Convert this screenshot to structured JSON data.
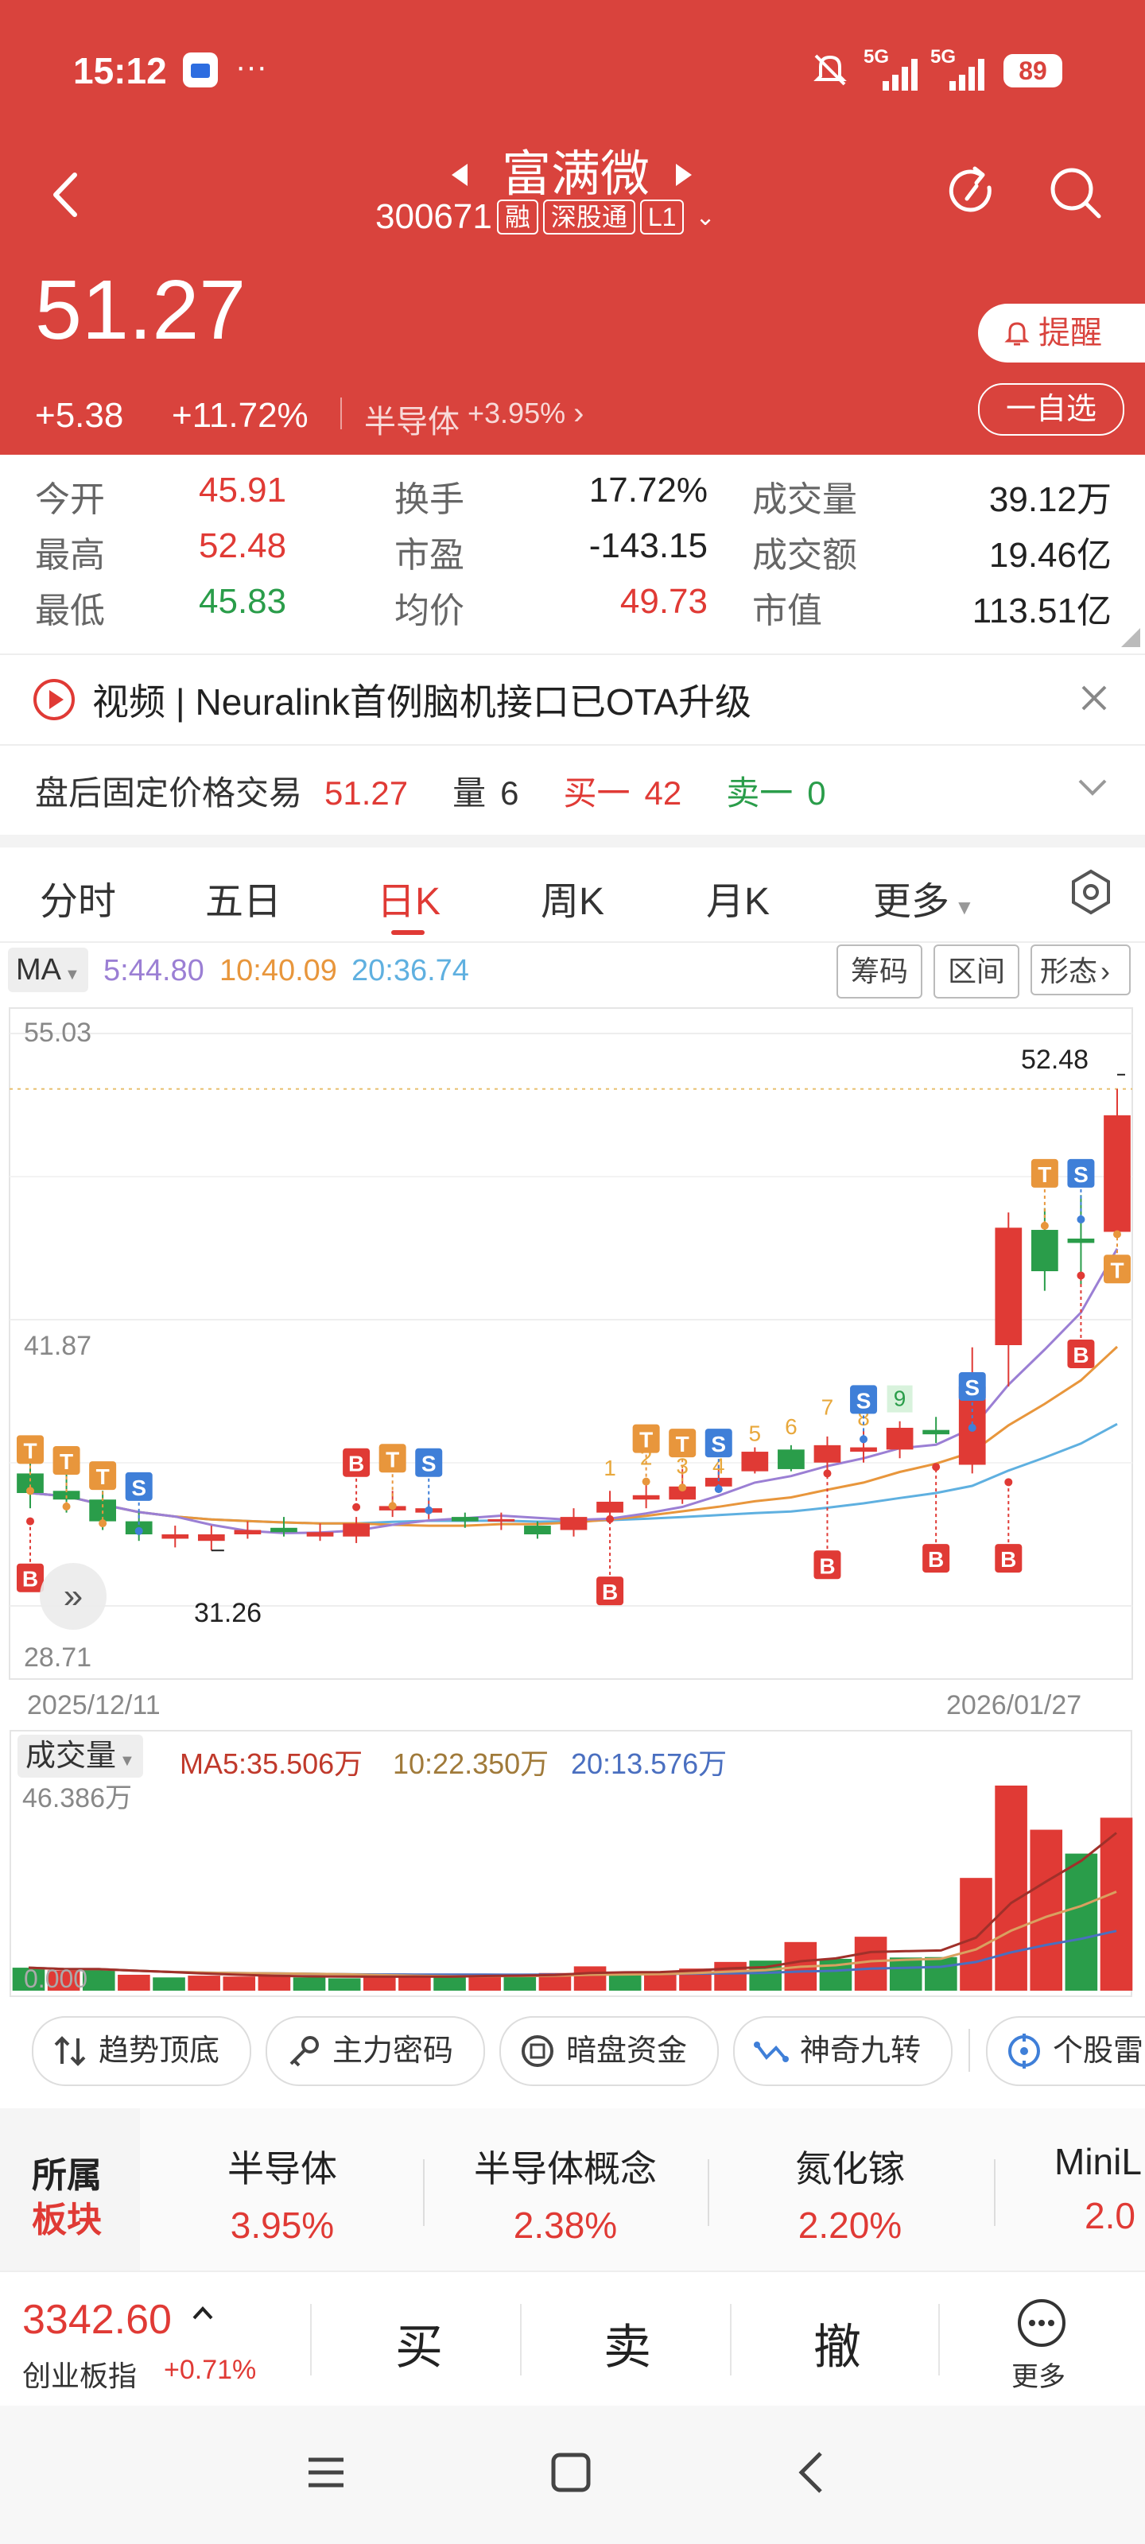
{
  "status_bar": {
    "time": "15:12",
    "network1": "5G",
    "network2": "5G",
    "battery": "89"
  },
  "header": {
    "stock_name": "富满微",
    "stock_code": "300671",
    "badges": [
      "融",
      "深股通",
      "L1"
    ],
    "price": "51.27",
    "change": "+5.38",
    "change_pct": "+11.72%",
    "sector_name": "半导体",
    "sector_change": "+3.95%",
    "alert_label": "提醒",
    "watchlist_label": "一自选"
  },
  "quote": {
    "rows": [
      [
        {
          "label": "今开",
          "value": "45.91",
          "color": "red"
        },
        {
          "label": "换手",
          "value": "17.72%",
          "color": "dark"
        },
        {
          "label": "成交量",
          "value": "39.12万",
          "color": "dark"
        }
      ],
      [
        {
          "label": "最高",
          "value": "52.48",
          "color": "red"
        },
        {
          "label": "市盈",
          "value": "-143.15",
          "color": "dark"
        },
        {
          "label": "成交额",
          "value": "19.46亿",
          "color": "dark"
        }
      ],
      [
        {
          "label": "最低",
          "value": "45.83",
          "color": "green"
        },
        {
          "label": "均价",
          "value": "49.73",
          "color": "red"
        },
        {
          "label": "市值",
          "value": "113.51亿",
          "color": "dark"
        }
      ]
    ]
  },
  "news": {
    "text": "视频 | Neuralink首例脑机接口已OTA升级"
  },
  "after_hours": {
    "label": "盘后固定价格交易",
    "price": "51.27",
    "volume_label": "量",
    "volume": "6",
    "buy_label": "买一",
    "buy_value": "42",
    "sell_label": "卖一",
    "sell_value": "0"
  },
  "chart_tabs": [
    "分时",
    "五日",
    "日K",
    "周K",
    "月K",
    "更多"
  ],
  "active_tab": "日K",
  "ma_bar": {
    "label": "MA",
    "ma5": "5:44.80",
    "ma10": "10:40.09",
    "ma20": "20:36.74",
    "buttons": [
      "筹码",
      "区间",
      "形态"
    ]
  },
  "chart_labels": {
    "ymax": "55.03",
    "ymid": "41.87",
    "ymin": "28.71",
    "high_marker": "52.48",
    "low_marker": "31.26",
    "date_start": "2025/12/11",
    "date_end": "2026/01/27"
  },
  "volume_bar": {
    "label": "成交量",
    "ma5": "MA5:35.506万",
    "ma10": "10:22.350万",
    "ma20": "20:13.576万",
    "ymax": "46.386万",
    "ymin": "0.000"
  },
  "colors": {
    "up": "#e03a35",
    "down": "#2a9d4a",
    "ma5": "#9b7fd4",
    "ma10": "#e8963c",
    "ma20": "#5fb0e0",
    "header": "#d9433d"
  },
  "chart_data": {
    "type": "candlestick",
    "ylim": [
      28.71,
      55.03
    ],
    "x_start": "2025/12/11",
    "x_end": "2026/01/27",
    "candles": [
      {
        "o": 34.8,
        "c": 33.9,
        "h": 35.6,
        "l": 33.2
      },
      {
        "o": 34.0,
        "c": 33.6,
        "h": 34.8,
        "l": 33.0
      },
      {
        "o": 33.6,
        "c": 32.6,
        "h": 34.0,
        "l": 32.2
      },
      {
        "o": 32.6,
        "c": 32.0,
        "h": 33.0,
        "l": 31.7
      },
      {
        "o": 31.8,
        "c": 32.0,
        "h": 32.4,
        "l": 31.4
      },
      {
        "o": 31.7,
        "c": 32.0,
        "h": 32.4,
        "l": 31.26
      },
      {
        "o": 32.0,
        "c": 32.2,
        "h": 32.6,
        "l": 31.8
      },
      {
        "o": 32.3,
        "c": 32.1,
        "h": 32.8,
        "l": 31.9
      },
      {
        "o": 31.9,
        "c": 32.1,
        "h": 32.5,
        "l": 31.7
      },
      {
        "o": 31.9,
        "c": 32.5,
        "h": 32.8,
        "l": 31.6
      },
      {
        "o": 33.1,
        "c": 33.3,
        "h": 34.0,
        "l": 32.8
      },
      {
        "o": 33.0,
        "c": 33.2,
        "h": 33.6,
        "l": 32.7
      },
      {
        "o": 32.8,
        "c": 32.6,
        "h": 33.0,
        "l": 32.3
      },
      {
        "o": 32.6,
        "c": 32.7,
        "h": 33.0,
        "l": 32.2
      },
      {
        "o": 32.4,
        "c": 32.0,
        "h": 32.6,
        "l": 31.8
      },
      {
        "o": 32.2,
        "c": 32.8,
        "h": 33.2,
        "l": 31.9
      },
      {
        "o": 33.0,
        "c": 33.5,
        "h": 34.0,
        "l": 32.5
      },
      {
        "o": 33.6,
        "c": 33.8,
        "h": 34.6,
        "l": 33.2
      },
      {
        "o": 33.6,
        "c": 34.2,
        "h": 35.0,
        "l": 33.4
      },
      {
        "o": 34.2,
        "c": 34.6,
        "h": 35.2,
        "l": 34.0
      },
      {
        "o": 34.9,
        "c": 35.8,
        "h": 36.0,
        "l": 34.8
      },
      {
        "o": 35.9,
        "c": 35.0,
        "h": 36.1,
        "l": 34.9
      },
      {
        "o": 35.3,
        "c": 36.1,
        "h": 36.5,
        "l": 34.8
      },
      {
        "o": 35.8,
        "c": 36.0,
        "h": 36.8,
        "l": 35.3
      },
      {
        "o": 35.9,
        "c": 36.9,
        "h": 37.2,
        "l": 35.5
      },
      {
        "o": 36.8,
        "c": 36.6,
        "h": 37.4,
        "l": 36.2
      },
      {
        "o": 35.2,
        "c": 38.8,
        "h": 40.6,
        "l": 34.8
      },
      {
        "o": 40.7,
        "c": 46.1,
        "h": 46.8,
        "l": 38.8
      },
      {
        "o": 46.0,
        "c": 44.1,
        "h": 47.0,
        "l": 43.2
      },
      {
        "o": 45.6,
        "c": 45.4,
        "h": 47.6,
        "l": 43.5
      },
      {
        "o": 45.91,
        "c": 51.27,
        "h": 52.48,
        "l": 45.83
      }
    ],
    "volume_ylim": [
      0,
      46.386
    ],
    "volumes": [
      {
        "v": 5.2,
        "up": false
      },
      {
        "v": 4.6,
        "up": true
      },
      {
        "v": 4.8,
        "up": false
      },
      {
        "v": 3.6,
        "up": true
      },
      {
        "v": 3.0,
        "up": false
      },
      {
        "v": 3.4,
        "up": true
      },
      {
        "v": 3.2,
        "up": true
      },
      {
        "v": 3.6,
        "up": true
      },
      {
        "v": 3.0,
        "up": false
      },
      {
        "v": 2.8,
        "up": false
      },
      {
        "v": 3.2,
        "up": true
      },
      {
        "v": 3.3,
        "up": true
      },
      {
        "v": 3.5,
        "up": false
      },
      {
        "v": 3.8,
        "up": true
      },
      {
        "v": 3.2,
        "up": false
      },
      {
        "v": 4.0,
        "up": true
      },
      {
        "v": 5.5,
        "up": true
      },
      {
        "v": 4.3,
        "up": false
      },
      {
        "v": 4.0,
        "up": true
      },
      {
        "v": 5.0,
        "up": true
      },
      {
        "v": 6.5,
        "up": true
      },
      {
        "v": 6.8,
        "up": false
      },
      {
        "v": 11.0,
        "up": true
      },
      {
        "v": 7.2,
        "up": false
      },
      {
        "v": 12.2,
        "up": true
      },
      {
        "v": 7.5,
        "up": false
      },
      {
        "v": 7.6,
        "up": false
      },
      {
        "v": 25.5,
        "up": true
      },
      {
        "v": 46.386,
        "up": true
      },
      {
        "v": 36.4,
        "up": true
      },
      {
        "v": 31.0,
        "up": false
      },
      {
        "v": 39.12,
        "up": true
      }
    ]
  },
  "tool_chips": [
    "趋势顶底",
    "主力密码",
    "暗盘资金",
    "神奇九转",
    "个股雷"
  ],
  "sectors": {
    "title_line1": "所属",
    "title_line2": "板块",
    "items": [
      {
        "name": "半导体",
        "pct": "3.95%"
      },
      {
        "name": "半导体概念",
        "pct": "2.38%"
      },
      {
        "name": "氮化镓",
        "pct": "2.20%"
      },
      {
        "name": "MiniL",
        "pct": "2.0"
      }
    ]
  },
  "bottom_bar": {
    "index_value": "3342.60",
    "index_name": "创业板指",
    "index_change": "+0.71%",
    "buttons": [
      "买",
      "卖",
      "撤"
    ],
    "more_label": "更多"
  }
}
